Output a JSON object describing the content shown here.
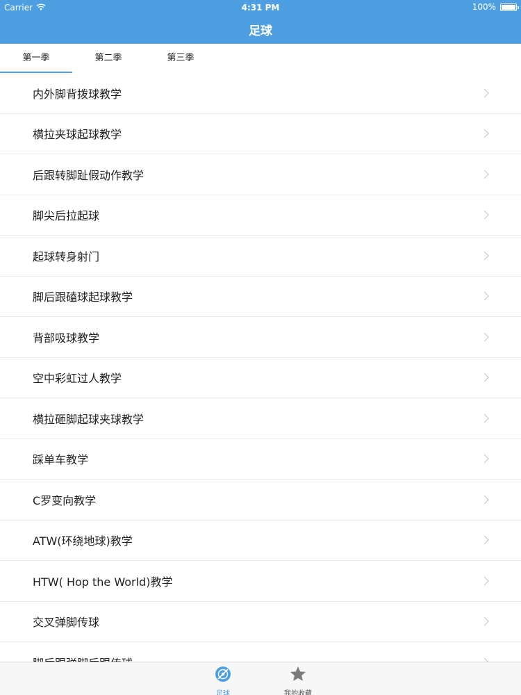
{
  "status_bar": {
    "carrier": "Carrier",
    "time": "4:31 PM",
    "battery": "100%"
  },
  "nav": {
    "title": "足球"
  },
  "tabs": [
    {
      "label": "第一季",
      "active": true
    },
    {
      "label": "第二季",
      "active": false
    },
    {
      "label": "第三季",
      "active": false
    }
  ],
  "list": {
    "items": [
      {
        "label": "内外脚背拨球教学"
      },
      {
        "label": "横拉夹球起球教学"
      },
      {
        "label": "后跟转脚趾假动作教学"
      },
      {
        "label": "脚尖后拉起球"
      },
      {
        "label": "起球转身射门"
      },
      {
        "label": "脚后跟磕球起球教学"
      },
      {
        "label": "背部吸球教学"
      },
      {
        "label": "空中彩虹过人教学"
      },
      {
        "label": "横拉砸脚起球夹球教学"
      },
      {
        "label": "踩单车教学"
      },
      {
        "label": "C罗变向教学"
      },
      {
        "label": "ATW(环绕地球)教学"
      },
      {
        "label": "HTW( Hop the World)教学"
      },
      {
        "label": "交叉弹脚传球"
      },
      {
        "label": "脚后跟弹脚后跟传球"
      }
    ]
  },
  "tabbar": {
    "items": [
      {
        "label": "足球",
        "icon": "soccer-icon",
        "active": true
      },
      {
        "label": "我的收藏",
        "icon": "star-icon",
        "active": false
      }
    ]
  },
  "colors": {
    "accent": "#4e9fe2",
    "star_gray": "#7b7b7b"
  }
}
